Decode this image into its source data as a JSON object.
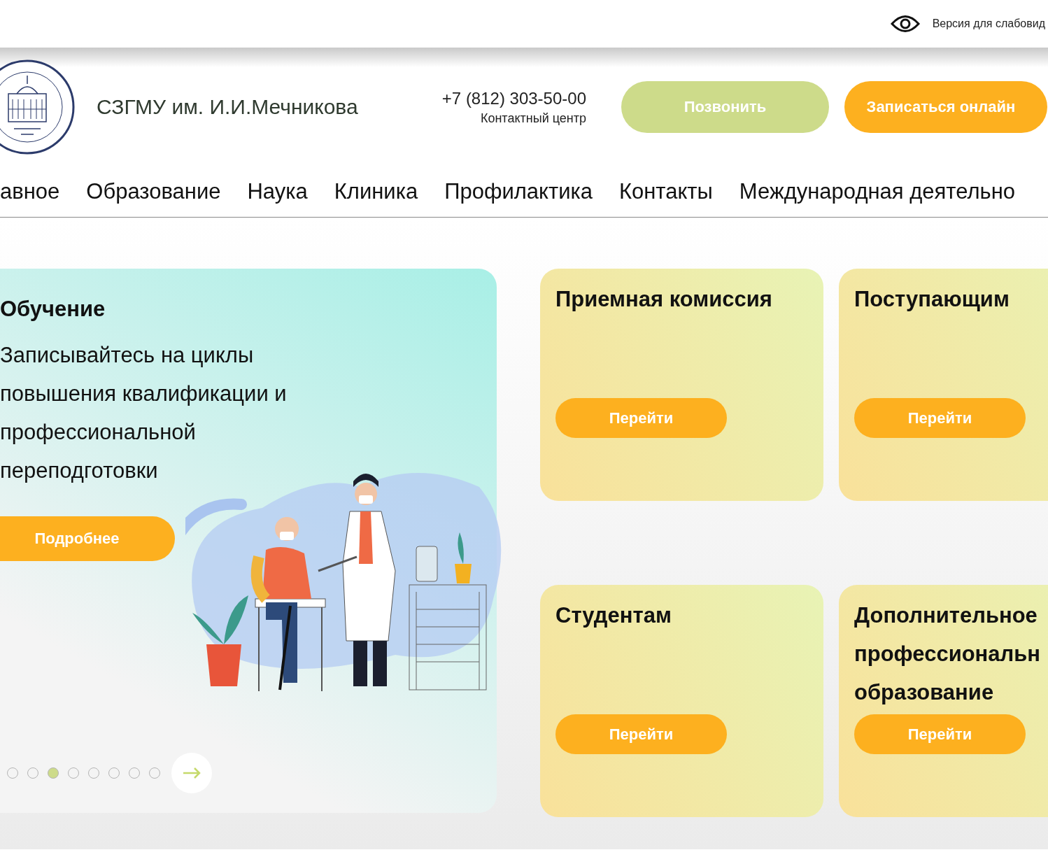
{
  "top_bar": {
    "accessibility_link": "Версия для слабовид"
  },
  "header": {
    "logo_title": "СЗГМУ им. И.И.Мечникова",
    "phone": "+7 (812) 303-50-00",
    "phone_caption": "Контактный центр",
    "buttons": [
      {
        "label": "Позвонить",
        "kind": "secondary"
      },
      {
        "label": "Записаться онлайн",
        "kind": "primary"
      }
    ]
  },
  "nav": [
    {
      "label": "авное"
    },
    {
      "label": "Образование"
    },
    {
      "label": "Наука"
    },
    {
      "label": "Клиника"
    },
    {
      "label": "Профилактика"
    },
    {
      "label": "Контакты"
    },
    {
      "label": "Международная деятельно"
    }
  ],
  "carousel": {
    "title": "Обучение",
    "text": "Записывайтесь на циклы повышения квалификации и профессиональной переподготовки",
    "button": "Подробнее",
    "slides": [
      {
        "selected": false
      },
      {
        "selected": false
      },
      {
        "selected": true
      },
      {
        "selected": false
      },
      {
        "selected": false
      },
      {
        "selected": false
      },
      {
        "selected": false
      },
      {
        "selected": false
      }
    ]
  },
  "cards": [
    {
      "title_lines": [
        "Приемная комиссия"
      ],
      "button": "Перейти"
    },
    {
      "title_lines": [
        "Поступающим"
      ],
      "button": "Перейти"
    },
    {
      "title_lines": [
        "Студентам"
      ],
      "button": "Перейти"
    },
    {
      "title_lines": [
        "Дополнительное",
        "профессиональн",
        "образование"
      ],
      "button": "Перейти"
    }
  ]
}
